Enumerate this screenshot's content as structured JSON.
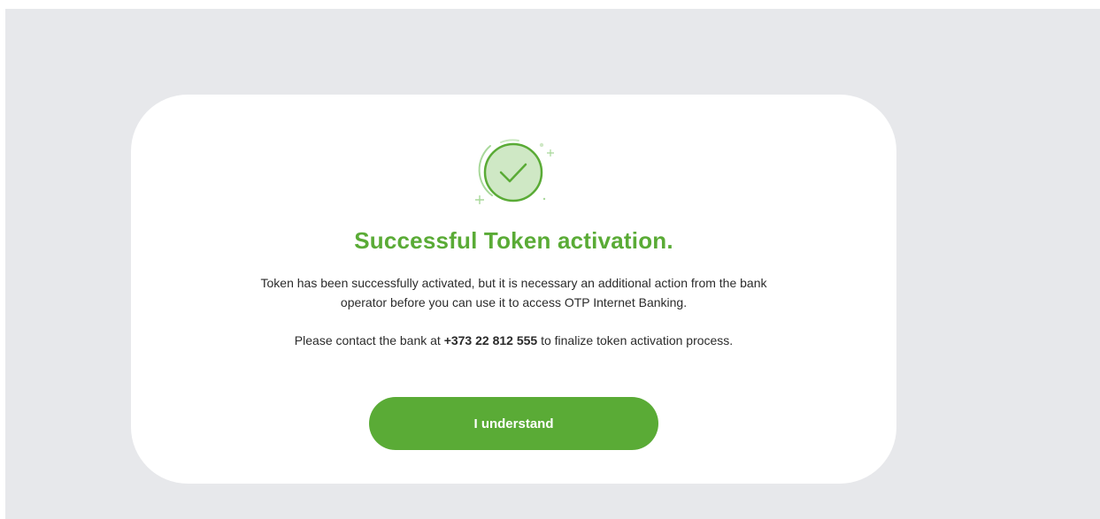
{
  "dialog": {
    "title": "Successful Token activation.",
    "message_line1": "Token has been successfully activated, but it is necessary an additional action from the bank",
    "message_line2": "operator before you can use it to access OTP Internet Banking.",
    "contact_prefix": "Please contact the bank at ",
    "phone": "+373 22 812 555",
    "contact_suffix": " to finalize token activation process.",
    "button_label": "I understand"
  },
  "icons": {
    "success": "check-circle-icon"
  },
  "colors": {
    "accent": "#5aab36",
    "page_background": "#e7e8eb",
    "card_background": "#ffffff",
    "text": "#2b2b2b"
  }
}
